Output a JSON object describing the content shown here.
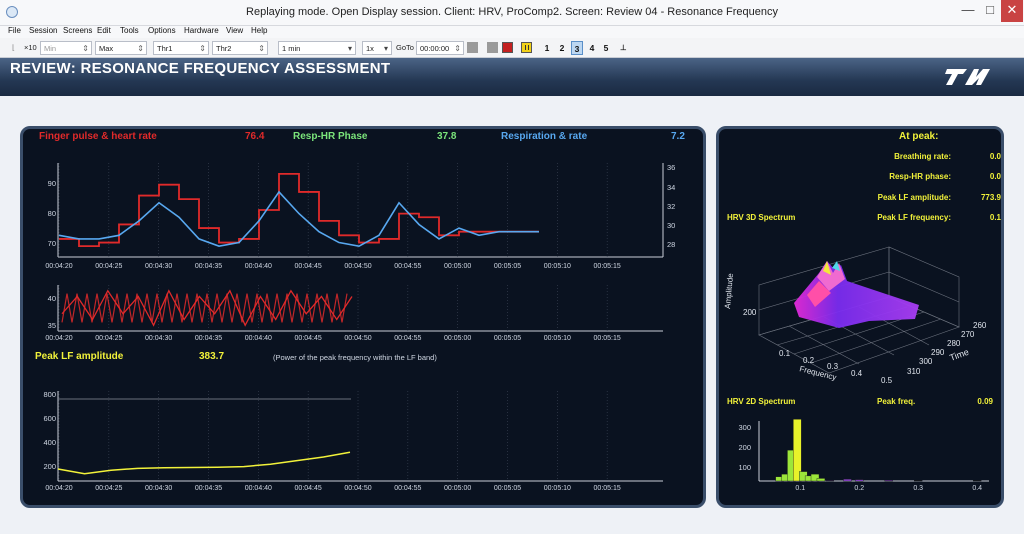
{
  "window": {
    "title": "Replaying mode. Open Display session. Client: HRV, ProComp2. Screen: Review 04 - Resonance Frequency",
    "minimize": "—",
    "maximize": "□",
    "close": "✕"
  },
  "menu": [
    "File",
    "Session",
    "Screens",
    "Edit",
    "Tools",
    "Options",
    "Hardware",
    "View",
    "Help"
  ],
  "toolbar": {
    "x10": "×10",
    "min": "Min",
    "max": "Max",
    "thr1": "Thr1",
    "thr2": "Thr2",
    "duration": "1 min",
    "speed": "1x",
    "goto_label": "GoTo",
    "goto_time": "00:00:00",
    "screens": [
      "1",
      "2",
      "3",
      "4",
      "5"
    ],
    "active_screen": "3"
  },
  "header": {
    "title": "REVIEW: RESONANCE FREQUENCY ASSESSMENT"
  },
  "left": {
    "hr_label": "Finger pulse & heart rate",
    "hr_value": "76.4",
    "phase_label": "Resp-HR Phase",
    "phase_value": "37.8",
    "resp_label": "Respiration & rate",
    "resp_value": "7.2",
    "lf_label": "Peak LF amplitude",
    "lf_value": "383.7",
    "lf_note": "(Power of the peak frequency within the LF band)",
    "time_ticks": [
      "00:04:20",
      "00:04:25",
      "00:04:30",
      "00:04:35",
      "00:04:40",
      "00:04:45",
      "00:04:50",
      "00:04:55",
      "00:05:00",
      "00:05:05",
      "00:05:10",
      "00:05:15"
    ],
    "chart1_yleft": [
      "90",
      "80",
      "70"
    ],
    "chart1_yright": [
      "36",
      "34",
      "32",
      "30",
      "28"
    ],
    "chart2_y": [
      "40",
      "35"
    ],
    "chart3_y": [
      "800",
      "600",
      "400",
      "200"
    ]
  },
  "right": {
    "at_peak": "At peak:",
    "stats": [
      {
        "label": "Breathing rate:",
        "value": "0.0"
      },
      {
        "label": "Resp-HR phase:",
        "value": "0.0"
      },
      {
        "label": "Peak LF amplitude:",
        "value": "773.9"
      },
      {
        "label": "Peak LF frequency:",
        "value": "0.1"
      }
    ],
    "spectrum3d_label": "HRV 3D Spectrum",
    "axis_amp": "Amplitude",
    "axis_amp_tick": "200",
    "axis_freq": "Frequency",
    "freq_ticks": [
      "0.1",
      "0.2",
      "0.3",
      "0.4",
      "0.5"
    ],
    "axis_time": "Time",
    "time_ticks": [
      "260",
      "270",
      "280",
      "290",
      "300",
      "310"
    ],
    "spectrum2d_label": "HRV 2D Spectrum",
    "peak_freq_label": "Peak freq.",
    "peak_freq_value": "0.09",
    "spec2d_y": [
      "300",
      "200",
      "100"
    ],
    "spec2d_x": [
      "0.1",
      "0.2",
      "0.3",
      "0.4"
    ]
  },
  "chart_data": [
    {
      "type": "line",
      "title": "Finger pulse & heart rate / Respiration & rate",
      "x": [
        260,
        262,
        264,
        266,
        268,
        270,
        272,
        274,
        276,
        278,
        280,
        282,
        284,
        286,
        288,
        290,
        292,
        294,
        296,
        298,
        300,
        302,
        304,
        306,
        308
      ],
      "series": [
        {
          "name": "Finger pulse & heart rate",
          "values": [
            73,
            71,
            72,
            77,
            85,
            88,
            84,
            76,
            72,
            73,
            81,
            91,
            86,
            78,
            74,
            72,
            73,
            80,
            79,
            74,
            75,
            75,
            75,
            75,
            75
          ],
          "color": "#e02a2a"
        },
        {
          "name": "Respiration & rate",
          "values": [
            74,
            73,
            73,
            74,
            78,
            83,
            79,
            73,
            71,
            72,
            78,
            86,
            80,
            75,
            72,
            71,
            74,
            83,
            77,
            73,
            76,
            74,
            75,
            75,
            75
          ],
          "color": "#58a8f0"
        }
      ],
      "ylim": [
        68,
        94
      ],
      "y2lim": [
        27,
        37
      ]
    },
    {
      "type": "line",
      "title": "Respiration",
      "series": [
        {
          "name": "Respiration",
          "values": [
            37,
            40,
            36,
            41,
            37,
            40,
            35,
            41,
            36,
            40,
            37,
            41,
            35,
            40,
            36,
            41,
            37,
            40,
            36,
            40
          ],
          "color": "#e02a2a"
        }
      ],
      "ylim": [
        34,
        42
      ]
    },
    {
      "type": "line",
      "title": "Peak LF amplitude",
      "series": [
        {
          "name": "Peak LF amplitude",
          "values": [
            250,
            210,
            240,
            255,
            260,
            262,
            265,
            270,
            290,
            320,
            350,
            390
          ],
          "color": "#f2f23a"
        }
      ],
      "ylim": [
        150,
        900
      ]
    },
    {
      "type": "bar",
      "title": "HRV 2D Spectrum",
      "categories": [
        0.065,
        0.075,
        0.085,
        0.095,
        0.105,
        0.115,
        0.125,
        0.135,
        0.15,
        0.18,
        0.2,
        0.25,
        0.3,
        0.35,
        0.4
      ],
      "values": [
        25,
        40,
        180,
        360,
        55,
        30,
        40,
        15,
        3,
        10,
        8,
        5,
        2,
        0,
        2
      ],
      "ylim": [
        0,
        350
      ]
    }
  ]
}
